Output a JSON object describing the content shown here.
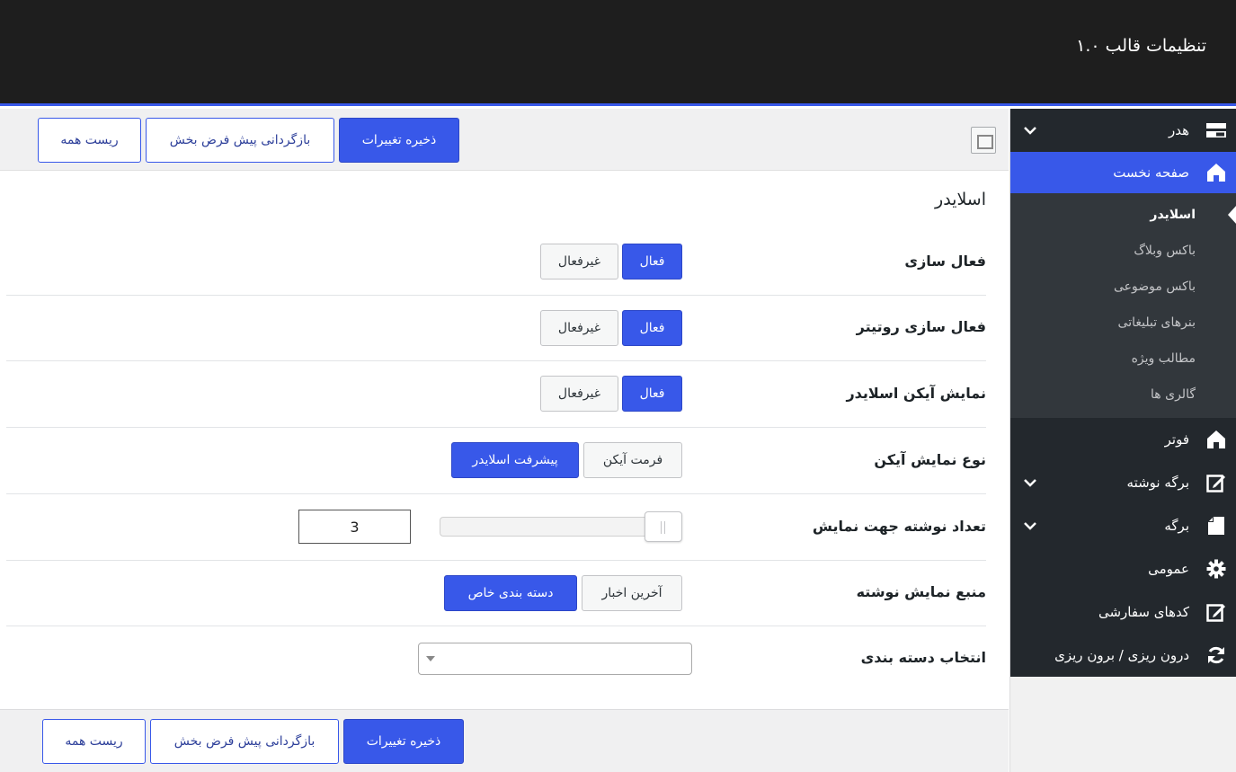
{
  "header": {
    "title": "تنظیمات قالب ۱.۰"
  },
  "toolbar": {
    "save_label": "ذخیره تغییرات",
    "restore_label": "بازگردانی پیش فرض بخش",
    "reset_label": "ریست همه"
  },
  "sidebar": {
    "items": [
      {
        "label": "هدر",
        "icon": "header-icon",
        "has_submenu": true
      },
      {
        "label": "صفحه نخست",
        "icon": "home-icon",
        "active": true
      },
      {
        "label": "فوتر",
        "icon": "home-icon"
      },
      {
        "label": "برگه نوشته",
        "icon": "edit-icon",
        "has_submenu": true
      },
      {
        "label": "برگه",
        "icon": "page-icon",
        "has_submenu": true
      },
      {
        "label": "عمومی",
        "icon": "gear-icon"
      },
      {
        "label": "کدهای سفارشی",
        "icon": "edit-icon"
      },
      {
        "label": "درون ریزی / برون ریزی",
        "icon": "refresh-icon"
      }
    ],
    "submenu": [
      {
        "label": "اسلایدر",
        "current": true
      },
      {
        "label": "باکس وبلاگ"
      },
      {
        "label": "باکس موضوعی"
      },
      {
        "label": "بنرهای تبلیغاتی"
      },
      {
        "label": "مطالب ویژه"
      },
      {
        "label": "گالری ها"
      }
    ]
  },
  "main": {
    "section_title": "اسلایدر",
    "fields": {
      "activation": {
        "label": "فعال سازی",
        "on": "فعال",
        "off": "غیرفعال",
        "selected": "فعال"
      },
      "router_activation": {
        "label": "فعال سازی روتیتر",
        "on": "فعال",
        "off": "غیرفعال",
        "selected": "فعال"
      },
      "show_slider_icon": {
        "label": "نمایش آیکن اسلایدر",
        "on": "فعال",
        "off": "غیرفعال",
        "selected": "فعال"
      },
      "icon_display_type": {
        "label": "نوع نمایش آیکن",
        "option_a": "پیشرفت اسلایدر",
        "option_b": "فرمت آیکن",
        "selected": "پیشرفت اسلایدر"
      },
      "post_count": {
        "label": "تعداد نوشته جهت نمایش",
        "value": "3"
      },
      "post_source": {
        "label": "منبع نمایش نوشته",
        "option_a": "دسته بندی خاص",
        "option_b": "آخرین اخبار",
        "selected": "دسته بندی خاص"
      },
      "category_select": {
        "label": "انتخاب دسته بندی",
        "value": ""
      }
    }
  },
  "colors": {
    "accent": "#3858e9",
    "topbar": "#1e1e1e",
    "sidebar_dark": "#23282d",
    "submenu_bg": "#32373c"
  }
}
